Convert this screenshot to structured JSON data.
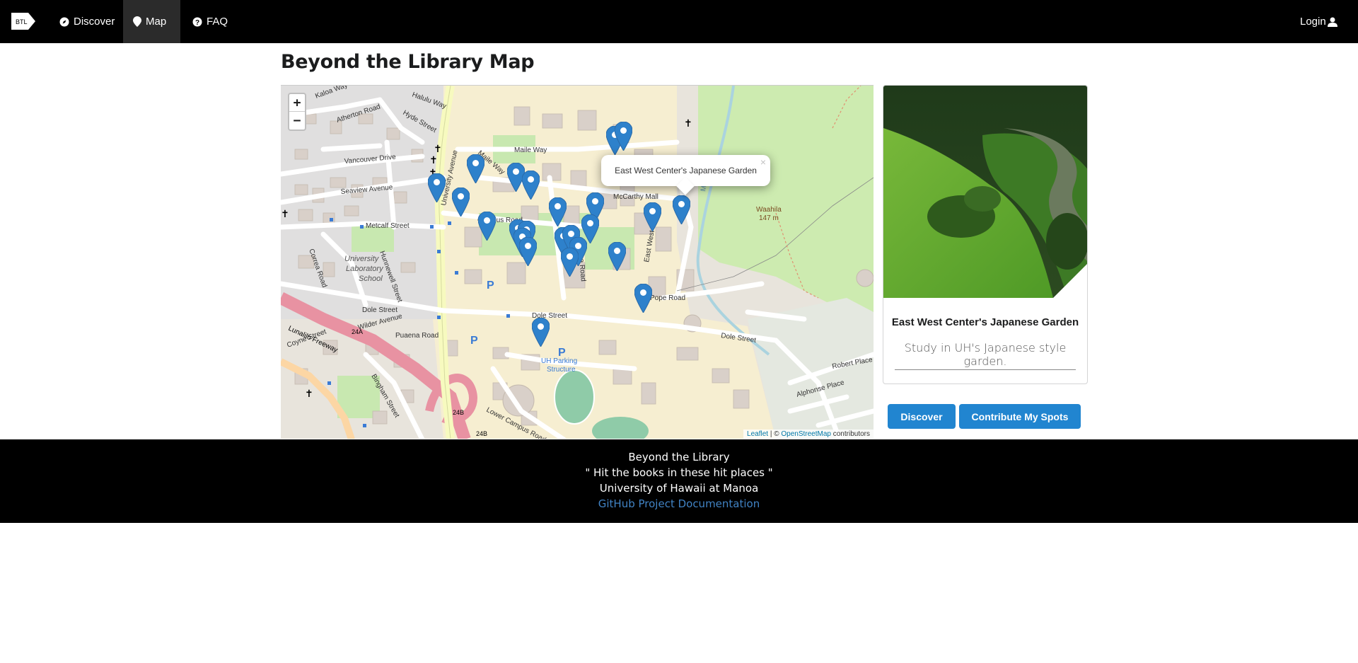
{
  "nav": {
    "brand_text": "BTL",
    "discover": "Discover",
    "map": "Map",
    "faq": "FAQ",
    "login": "Login"
  },
  "page": {
    "title": "Beyond the Library Map"
  },
  "map": {
    "zoom_in": "+",
    "zoom_out": "−",
    "popup_text": "East West Center's Japanese Garden",
    "popup_close": "×",
    "attribution_leaflet": "Leaflet",
    "attribution_sep": " | © ",
    "attribution_osm": "OpenStreetMap",
    "attribution_tail": " contributors",
    "labels": {
      "kaloa": "Kaloa Way",
      "halulu": "Halulu Way",
      "atherton": "Atherton Road",
      "hyde": "Hyde Street",
      "vancouver": "Vancouver Drive",
      "seaview": "Seaview Avenue",
      "metcalf": "Metcalf Street",
      "university_ave": "University Avenue",
      "maile": "Maile Way",
      "mccarthy": "McCarthy Mall",
      "campus": "Campus Road",
      "dole": "Dole Street",
      "pope": "Pope Road",
      "eastwest": "East West Road",
      "waahila": "Waahila",
      "waahila_elev": "147 m",
      "uls1": "University",
      "uls2": "Laboratory",
      "uls3": "School",
      "lunalilo": "Lunalilo Freeway",
      "puaena": "Puaena Road",
      "coyne": "Coyne Street",
      "wilder": "Wilder Avenue",
      "bingham": "Bingham Street",
      "uh_parking1": "UH Parking",
      "uh_parking2": "Structure",
      "lower_campus": "Lower Campus Road",
      "robert": "Robert Place",
      "alphonse": "Alphonse Place",
      "route24a": "24A",
      "route24b": "24B",
      "manoa": "Manoa",
      "hunnewell": "Hunnewell Street",
      "correa": "Correa Road",
      "dole_street2": "Dole Street"
    }
  },
  "card": {
    "title": "East West Center's Japanese Garden",
    "description": "Study in UH's Japanese style garden."
  },
  "buttons": {
    "discover": "Discover",
    "contribute": "Contribute My Spots"
  },
  "footer": {
    "line1": "Beyond the Library",
    "line2": "\" Hit the books in these hit places \"",
    "line3": "University of Hawaii at Manoa",
    "link": "GitHub Project Documentation"
  },
  "colors": {
    "marker": "#2e81cb",
    "button": "#2185d0",
    "navbar": "#000000",
    "footer_link": "#4183c4"
  }
}
